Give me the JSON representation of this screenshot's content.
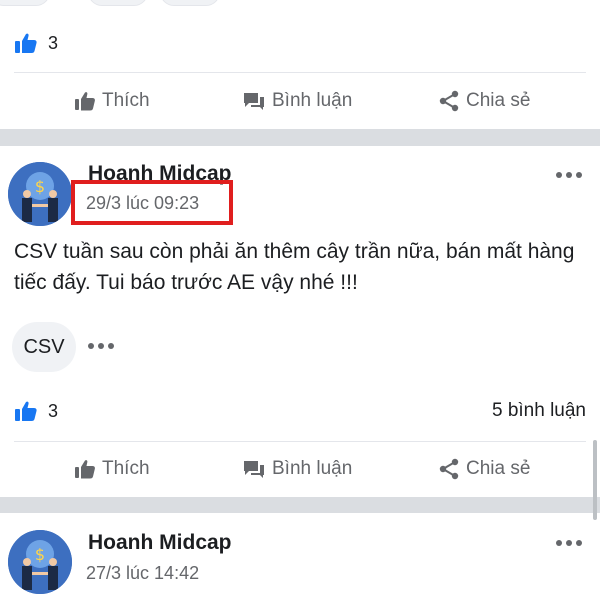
{
  "previous_post": {
    "likes_count": "3",
    "actions": {
      "like": "Thích",
      "comment": "Bình luận",
      "share": "Chia sẻ"
    }
  },
  "post": {
    "author": "Hoanh Midcap",
    "timestamp": "29/3 lúc 09:23",
    "text": "CSV tuần sau còn phải ăn thêm cây trần nữa, bán mất hàng tiếc đấy. Tui báo trước AE vậy nhé !!!",
    "tag": "CSV",
    "likes_count": "3",
    "comments_count": "5 bình luận",
    "actions": {
      "like": "Thích",
      "comment": "Bình luận",
      "share": "Chia sẻ"
    }
  },
  "next_post": {
    "author": "Hoanh Midcap",
    "timestamp": "27/3 lúc 14:42"
  },
  "colors": {
    "like_blue": "#1877f2",
    "highlight_red": "#e01e1e",
    "muted_text": "#65676b"
  }
}
